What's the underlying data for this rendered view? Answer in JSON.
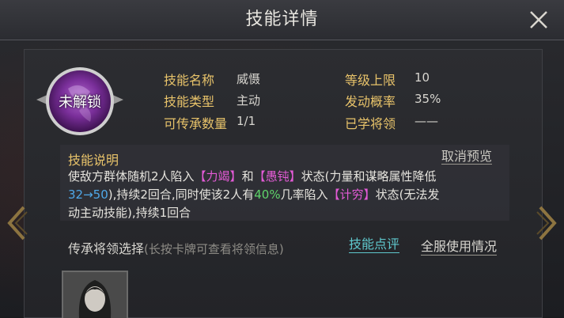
{
  "header": {
    "title": "技能详情"
  },
  "skill": {
    "icon_label": "未解锁",
    "info": [
      {
        "label": "技能名称",
        "value": "威慑"
      },
      {
        "label": "等级上限",
        "value": "10"
      },
      {
        "label": "技能类型",
        "value": "主动"
      },
      {
        "label": "发动概率",
        "value": "35%"
      },
      {
        "label": "可传承数量",
        "value": "1/1"
      },
      {
        "label": "已学将领",
        "value": "——"
      }
    ]
  },
  "description": {
    "title": "技能说明",
    "cancel_preview": "取消预览",
    "line1": [
      {
        "text": "使敌方群体随机2人陷入",
        "style": ""
      },
      {
        "text": "【力竭】",
        "style": "pink"
      },
      {
        "text": "和",
        "style": ""
      },
      {
        "text": "【愚钝】",
        "style": "pink"
      },
      {
        "text": "状态(力量和谋略属性降低",
        "style": ""
      }
    ],
    "line2": [
      {
        "text": "32→50",
        "style": "blue"
      },
      {
        "text": "),持续2回合,同时使该2人有",
        "style": ""
      },
      {
        "text": "40%",
        "style": "green"
      },
      {
        "text": "几率陷入",
        "style": ""
      },
      {
        "text": "【计穷】",
        "style": "pink"
      },
      {
        "text": "状态(无法发",
        "style": ""
      }
    ],
    "line3": [
      {
        "text": "动主动技能),持续1回合",
        "style": ""
      }
    ]
  },
  "inherit": {
    "title": "传承将领选择",
    "hint": "(长按卡牌可查看将领信息)",
    "review_button": "技能点评",
    "usage_button": "全服使用情况"
  },
  "colors": {
    "gold_label": "#e8c36a",
    "pink_highlight": "#e45bd7",
    "green_highlight": "#5fd46a",
    "blue_highlight": "#4fa8e8",
    "teal_link": "#5fc7cc"
  },
  "icons": {
    "close": "close-icon",
    "left": "chevron-left-icon",
    "right": "chevron-right-icon"
  }
}
